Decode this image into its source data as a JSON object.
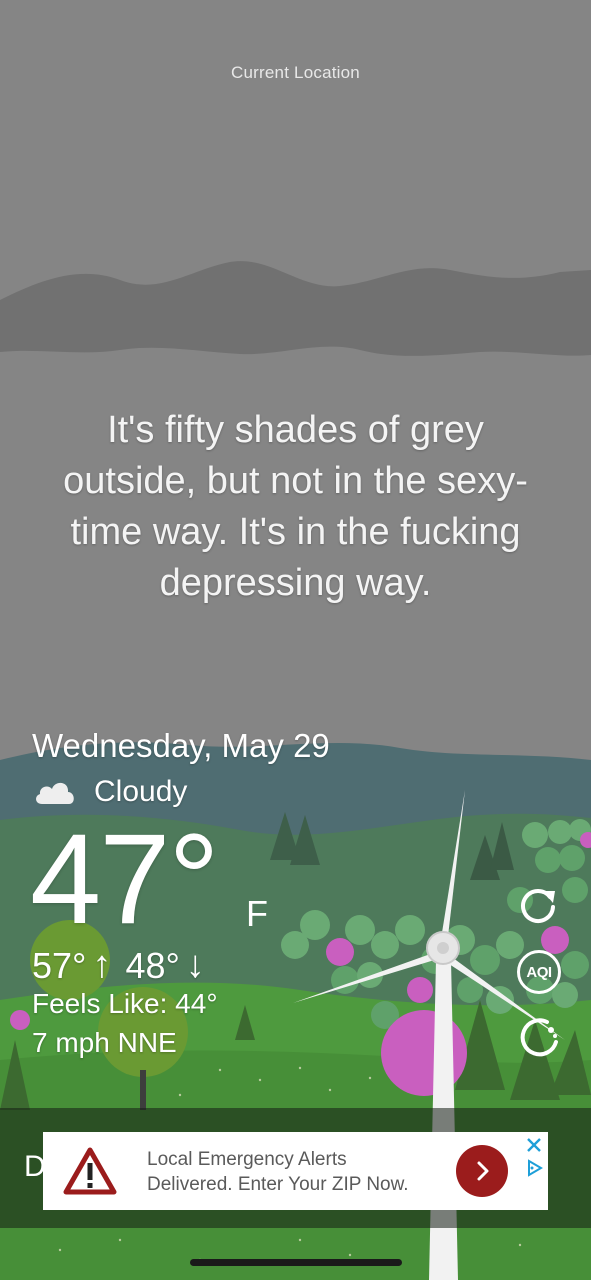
{
  "header": {
    "location": "Current Location"
  },
  "quote": "It's fifty shades of grey outside, but not in the sexy-time way. It's in the fucking depressing way.",
  "weather": {
    "date": "Wednesday, May 29",
    "condition": "Cloudy",
    "condition_icon": "cloud-icon",
    "temperature": "47°",
    "unit": "F",
    "high": "57°",
    "high_arrow": "↑",
    "low": "48°",
    "low_arrow": "↓",
    "feels_like": "Feels Like: 44°",
    "wind": "7 mph NNE"
  },
  "side_actions": {
    "refresh_icon": "refresh-icon",
    "aqi_label": "AQI",
    "loading_icon": "spinner-icon"
  },
  "bottom": {
    "partial_text": "D"
  },
  "ad": {
    "line1": "Local Emergency Alerts",
    "line2": "Delivered. Enter Your ZIP Now.",
    "warning_icon": "warning-icon",
    "go_icon": "chevron-right-icon",
    "close_icon": "close-icon",
    "adchoices_icon": "adchoices-icon"
  },
  "colors": {
    "sky": "#858585",
    "cloud_band": "#717171",
    "far_hills": "#4f6d72",
    "mid_hills": "#4e7a5b",
    "meadow": "#4e9a3e",
    "pink_tree": "#c95fbf",
    "ad_button": "#9b1c1c"
  }
}
